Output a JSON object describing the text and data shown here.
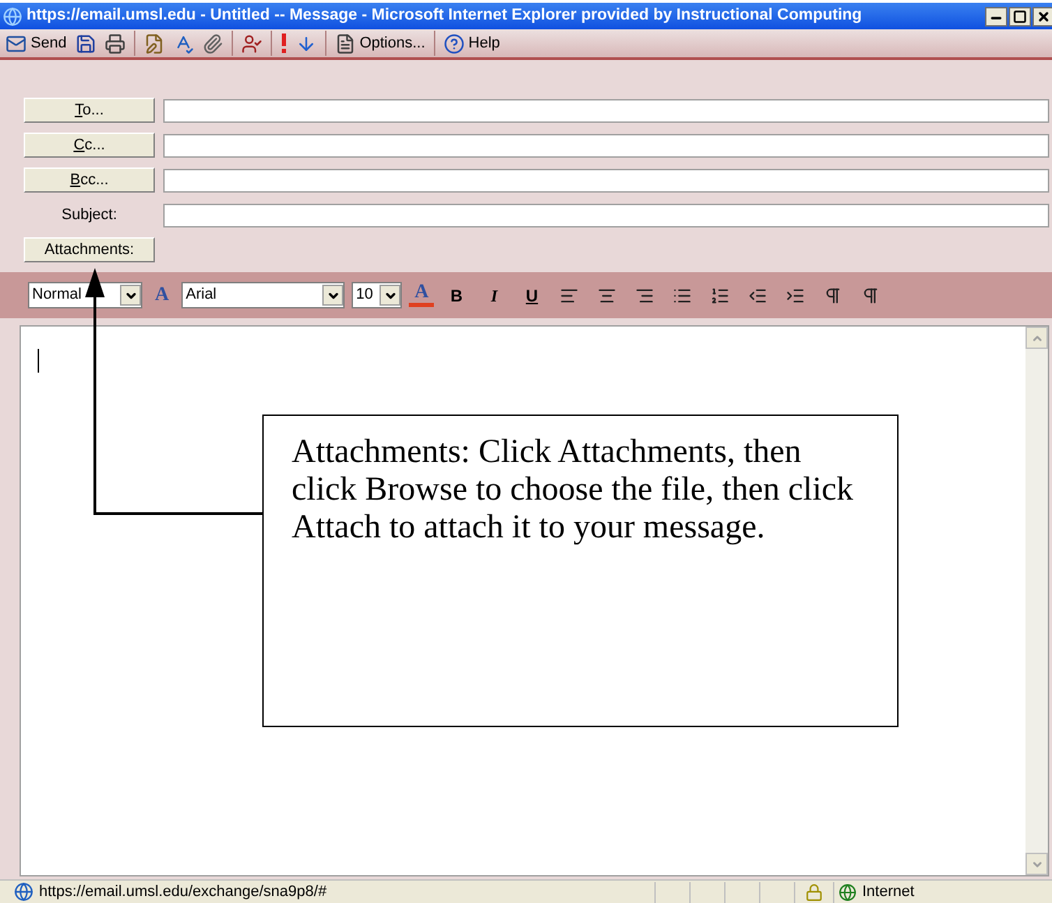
{
  "window": {
    "title": "https://email.umsl.edu - Untitled -- Message - Microsoft Internet Explorer provided by Instructional Computing"
  },
  "toolbar": [
    {
      "kind": "send",
      "label": "Send"
    },
    {
      "kind": "save"
    },
    {
      "kind": "print"
    },
    {
      "kind": "sep"
    },
    {
      "kind": "edit"
    },
    {
      "kind": "spell"
    },
    {
      "kind": "attach"
    },
    {
      "kind": "sep"
    },
    {
      "kind": "names"
    },
    {
      "kind": "sep"
    },
    {
      "kind": "high"
    },
    {
      "kind": "low"
    },
    {
      "kind": "sep"
    },
    {
      "kind": "options",
      "label": "Options..."
    },
    {
      "kind": "sep"
    },
    {
      "kind": "help",
      "label": "Help"
    }
  ],
  "address": [
    {
      "kind": "button",
      "label": "To...",
      "underline_first": true
    },
    {
      "kind": "button",
      "label": "Cc...",
      "underline_first": true
    },
    {
      "kind": "button",
      "label": "Bcc...",
      "underline_first": true
    },
    {
      "kind": "label",
      "label": "Subject:",
      "underline_first": false
    }
  ],
  "attachments_button": "Attachments:",
  "format_bar": {
    "style": "Normal",
    "style_icon": "A",
    "font": "Arial",
    "size": "10",
    "color_letter": "A",
    "bold": "B",
    "italic": "I",
    "underline": "U",
    "tools": [
      {
        "kind": "align-left"
      },
      {
        "kind": "align-center"
      },
      {
        "kind": "align-right"
      },
      {
        "kind": "bullets"
      },
      {
        "kind": "numbering"
      },
      {
        "kind": "outdent"
      },
      {
        "kind": "indent"
      },
      {
        "kind": "ltr"
      },
      {
        "kind": "rtl"
      }
    ]
  },
  "annotation": {
    "text": "Attachments: Click Attachments, then click Browse to choose the file, then click Attach to attach it to your message."
  },
  "status_bar": {
    "url": "https://email.umsl.edu/exchange/sna9p8/#",
    "zone": "Internet"
  }
}
